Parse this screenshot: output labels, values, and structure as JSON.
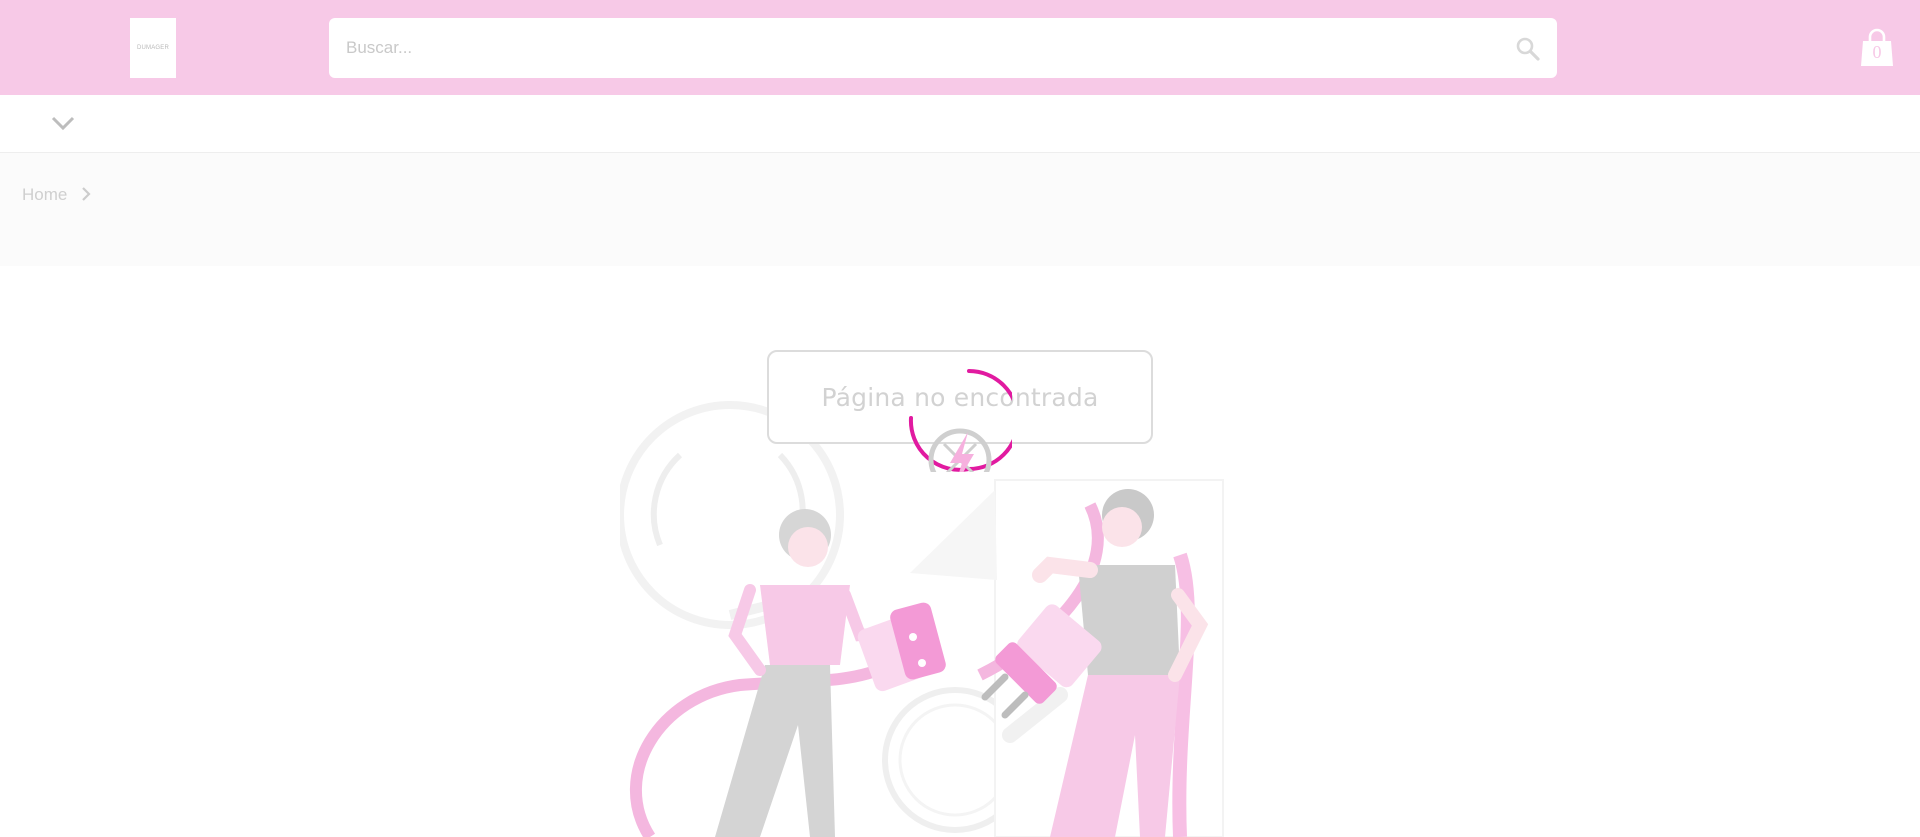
{
  "header": {
    "logo": {
      "text": "DUMAGER",
      "icon": "store-logo"
    },
    "search": {
      "placeholder": "Buscar...",
      "value": "",
      "icon": "search-icon"
    },
    "cart": {
      "count": "0",
      "icon": "shopping-bag-icon"
    },
    "brand_color": "#f7c9e7"
  },
  "nav": {
    "menu_icon": "chevron-down-icon"
  },
  "breadcrumb": {
    "home_label": "Home",
    "separator_icon": "chevron-right-icon"
  },
  "main": {
    "message": "Página no encontrada",
    "illustration": "unplugged-cable-illustration",
    "loading_icon": "spinner-icon",
    "accent_color": "#e11aa0"
  }
}
